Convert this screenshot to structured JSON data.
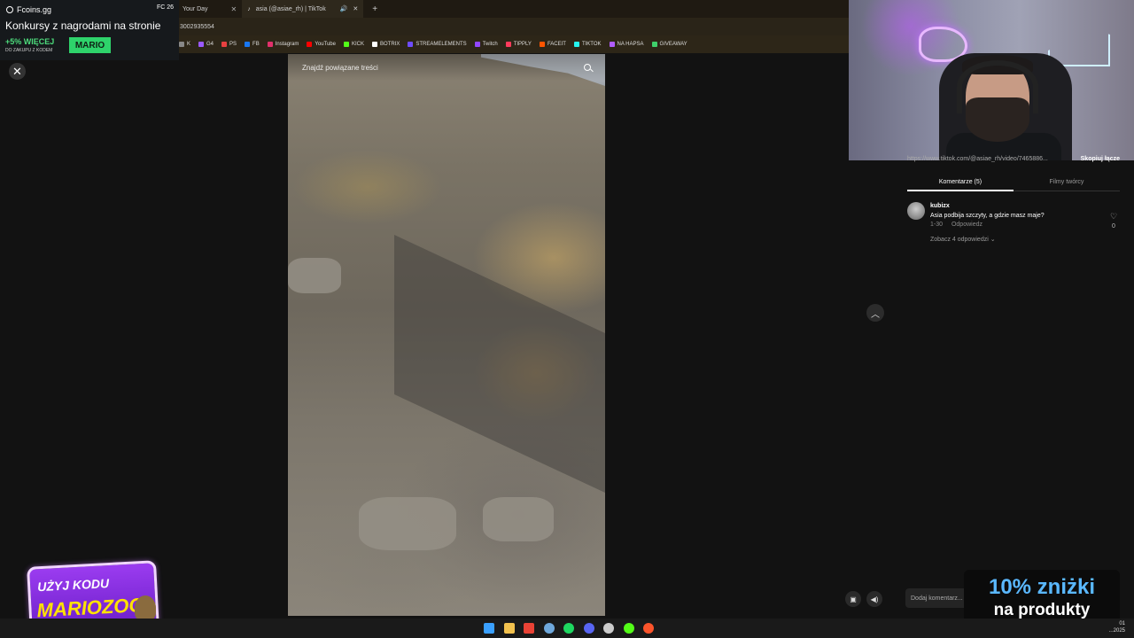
{
  "browser": {
    "tabs": [
      {
        "label": "Your Day"
      },
      {
        "label": "asia (@asiae_rh) | TikTok"
      }
    ],
    "url": "3002935554",
    "bookmarks": [
      {
        "label": "K",
        "color": "#888888"
      },
      {
        "label": "G4",
        "color": "#9b59ff"
      },
      {
        "label": "PS",
        "color": "#e84040"
      },
      {
        "label": "FB",
        "color": "#1877f2"
      },
      {
        "label": "Instagram",
        "color": "#e1306c"
      },
      {
        "label": "YouTube",
        "color": "#ff0000"
      },
      {
        "label": "KICK",
        "color": "#53fc18"
      },
      {
        "label": "BOTRIX",
        "color": "#ffffff"
      },
      {
        "label": "STREAMELEMENTS",
        "color": "#6e4cff"
      },
      {
        "label": "Twitch",
        "color": "#9146ff"
      },
      {
        "label": "TIPPLY",
        "color": "#ff3b5c"
      },
      {
        "label": "FACEIT",
        "color": "#ff5500"
      },
      {
        "label": "TIKTOK",
        "color": "#25f4ee"
      },
      {
        "label": "NA HAPSA",
        "color": "#b05cff"
      },
      {
        "label": "GIVEAWAY",
        "color": "#3fcf6b"
      }
    ]
  },
  "promo": {
    "brand": "Fcoins.gg",
    "system_tray": "FC 26",
    "title": "Konkursy z nagrodami na stronie",
    "bonus": "+5% WIĘCEJ",
    "bonus_sub": "DO ZAKUPU Z KODEM",
    "code": "MARIO"
  },
  "video": {
    "search_placeholder": "Znajdź powiązane treści"
  },
  "panel": {
    "link": "https://www.tiktok.com/@asiae_rh/video/7465886...",
    "copy_label": "Skopiuj łącze",
    "tab_comments": "Komentarze (5)",
    "tab_creator": "Filmy twórcy",
    "comment": {
      "user": "kubizx",
      "text": "Asia podbija szczyty, a gdzie masz maje?",
      "date": "1-30",
      "reply": "Odpowiedz",
      "more": "Zobacz 4 odpowiedzi",
      "likes": "0"
    },
    "add_comment_placeholder": "Dodaj komentarz..."
  },
  "overlay": {
    "discount_line1": "10% zniżki",
    "discount_line2": "na produkty",
    "code_line1": "UŻYJ KODU",
    "code_line2": "MARIOZOO"
  },
  "taskbar": {
    "icons": [
      {
        "name": "windows-icon",
        "color": "#3aa0ff"
      },
      {
        "name": "folder-icon",
        "color": "#f2c14e"
      },
      {
        "name": "chrome-icon",
        "color": "#e94235"
      },
      {
        "name": "steam-icon",
        "color": "#6fa8dc"
      },
      {
        "name": "spotify-icon",
        "color": "#1ed760"
      },
      {
        "name": "discord-icon",
        "color": "#5865f2"
      },
      {
        "name": "obs-icon",
        "color": "#cccccc"
      },
      {
        "name": "kick-icon",
        "color": "#53fc18"
      },
      {
        "name": "brave-icon",
        "color": "#fb542b"
      }
    ],
    "time": "01",
    "date": "...2025"
  }
}
